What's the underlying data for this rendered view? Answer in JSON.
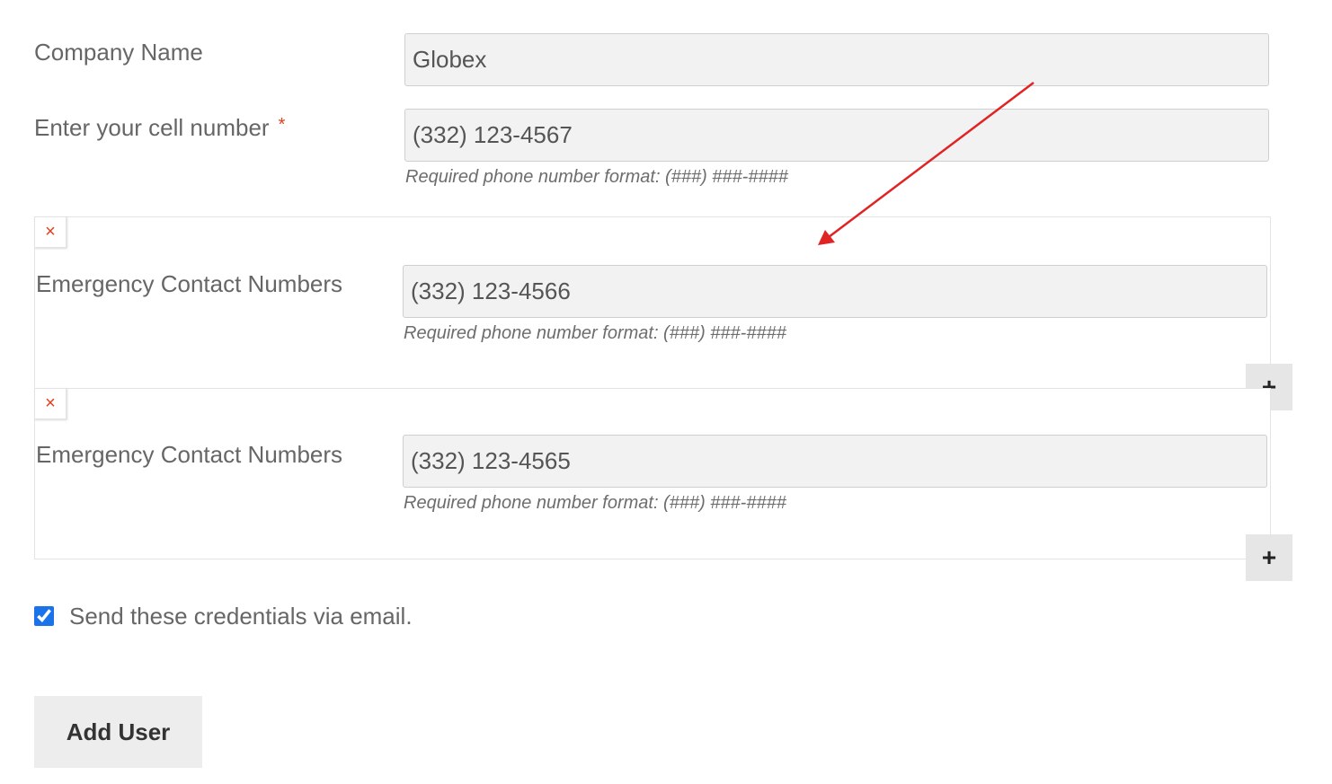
{
  "form": {
    "company_label": "Company Name",
    "company_value": "Globex",
    "cell_label": "Enter your cell number",
    "required_marker": "*",
    "cell_value": "(332) 123-4567",
    "phone_hint": "Required phone number format: (###) ###-####",
    "emergency_groups": [
      {
        "label": "Emergency Contact Numbers",
        "value": "(332) 123-4566",
        "hint": "Required phone number format: (###) ###-####",
        "remove_symbol": "×",
        "add_symbol": "+"
      },
      {
        "label": "Emergency Contact Numbers",
        "value": "(332) 123-4565",
        "hint": "Required phone number format: (###) ###-####",
        "remove_symbol": "×",
        "add_symbol": "+"
      }
    ],
    "send_credentials_label": "Send these credentials via email.",
    "send_credentials_checked": true,
    "submit_label": "Add User"
  },
  "colors": {
    "annotation_arrow": "#e02424",
    "remove_icon": "#e2401c",
    "checkbox_accent": "#1a73e8"
  }
}
